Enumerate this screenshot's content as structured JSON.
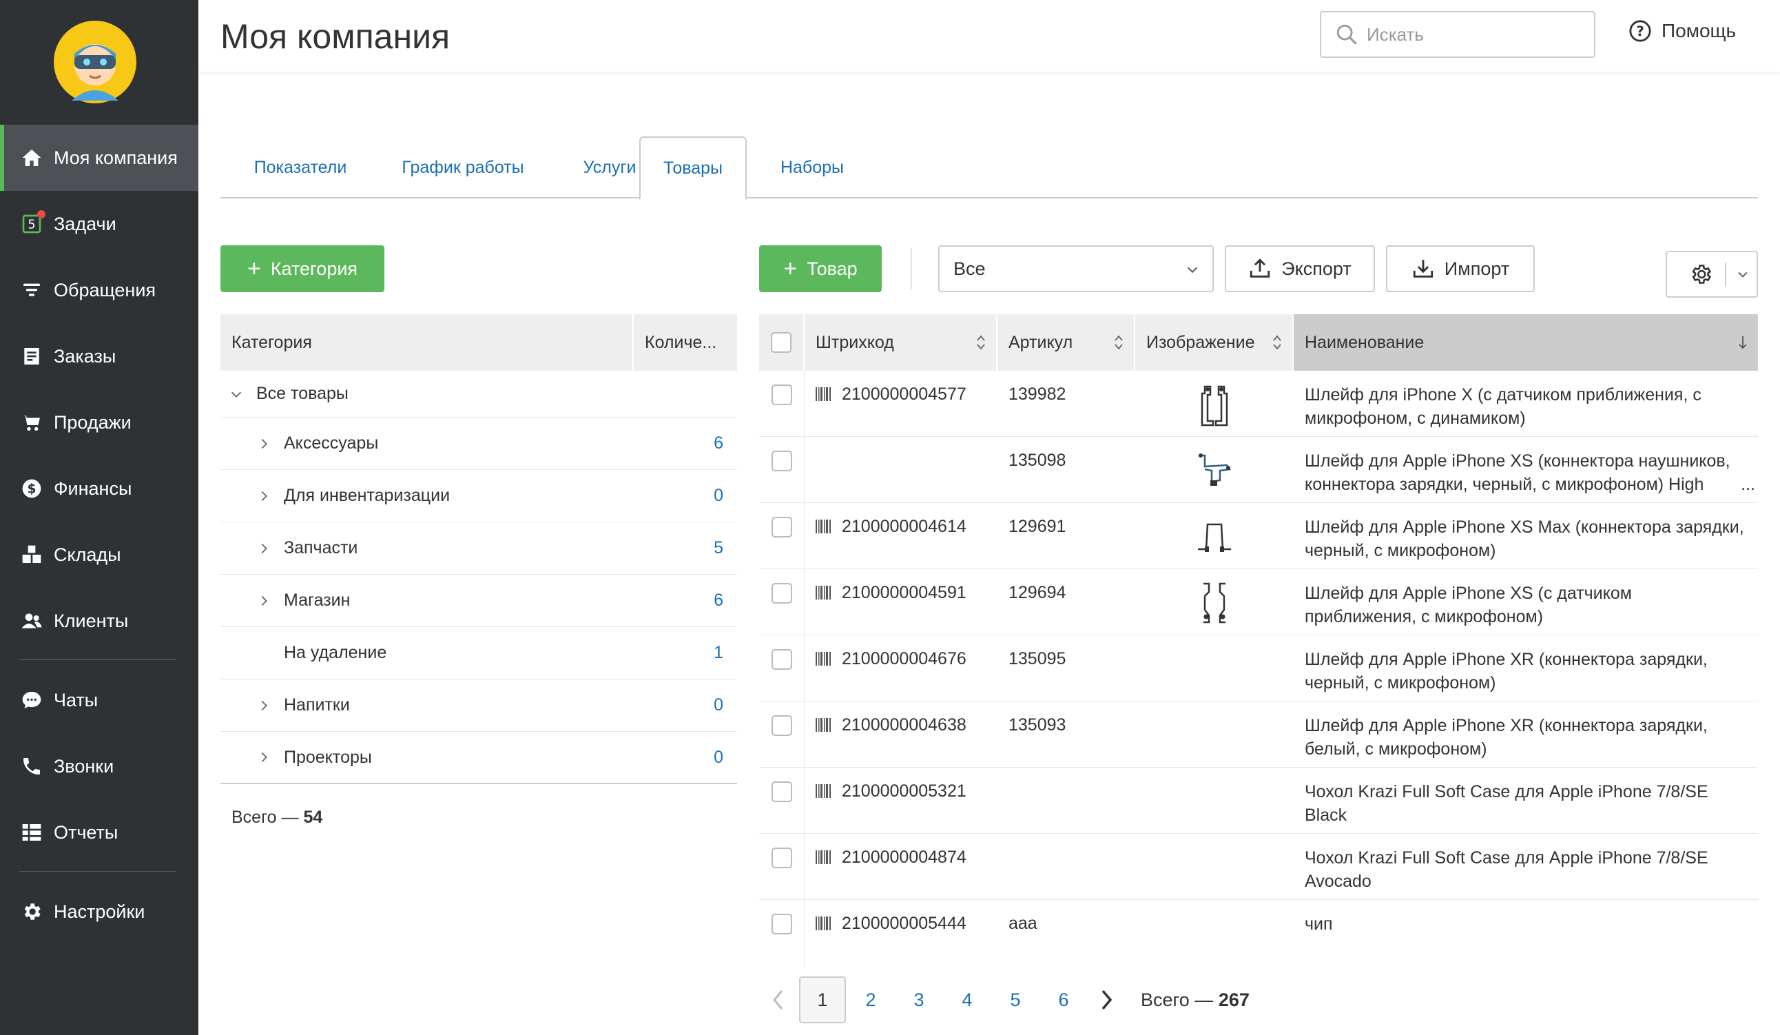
{
  "sidebar": {
    "items": [
      {
        "label": "Моя компания",
        "icon": "home-icon",
        "active": true
      },
      {
        "label": "Задачи",
        "icon": "tasks-icon",
        "badge": "5"
      },
      {
        "label": "Обращения",
        "icon": "funnel-icon"
      },
      {
        "label": "Заказы",
        "icon": "orders-icon"
      },
      {
        "label": "Продажи",
        "icon": "cart-icon"
      },
      {
        "label": "Финансы",
        "icon": "dollar-icon"
      },
      {
        "label": "Склады",
        "icon": "boxes-icon"
      },
      {
        "label": "Клиенты",
        "icon": "users-icon"
      },
      {
        "label": "Чаты",
        "icon": "chat-icon"
      },
      {
        "label": "Звонки",
        "icon": "phone-icon"
      },
      {
        "label": "Отчеты",
        "icon": "reports-icon"
      },
      {
        "label": "Настройки",
        "icon": "gear-icon"
      }
    ]
  },
  "header": {
    "title": "Моя компания",
    "search_placeholder": "Искать",
    "help_label": "Помощь"
  },
  "tabs": [
    {
      "label": "Показатели"
    },
    {
      "label": "График работы"
    },
    {
      "label": "Услуги"
    },
    {
      "label": "Товары",
      "active": true
    },
    {
      "label": "Наборы"
    }
  ],
  "toolbar": {
    "add_category_label": "Категория",
    "add_product_label": "Товар",
    "filter_value": "Все",
    "export_label": "Экспорт",
    "import_label": "Импорт"
  },
  "categories": {
    "header_name": "Категория",
    "header_count": "Количе...",
    "root_label": "Все товары",
    "items": [
      {
        "label": "Аксессуары",
        "count": "6",
        "expandable": true
      },
      {
        "label": "Для инвентаризации",
        "count": "0",
        "expandable": true
      },
      {
        "label": "Запчасти",
        "count": "5",
        "expandable": true
      },
      {
        "label": "Магазин",
        "count": "6",
        "expandable": true
      },
      {
        "label": "На удаление",
        "count": "1",
        "expandable": false
      },
      {
        "label": "Напитки",
        "count": "0",
        "expandable": true
      },
      {
        "label": "Проекторы",
        "count": "0",
        "expandable": true
      }
    ],
    "total_label": "Всего —",
    "total_value": "54"
  },
  "products": {
    "headers": {
      "barcode": "Штрихкод",
      "article": "Артикул",
      "image": "Изображение",
      "name": "Наименование"
    },
    "rows": [
      {
        "barcode": "2100000004577",
        "article": "139982",
        "has_image": true,
        "name_1": "Шлейф для iPhone X (с датчиком приближения, с",
        "name_2": "микрофоном, с динамиком)"
      },
      {
        "barcode": "",
        "article": "135098",
        "has_image": true,
        "name_1": "Шлейф для Apple iPhone XS (коннектора наушников,",
        "name_2": "коннектора зарядки, черный, с микрофоном) High",
        "ellipsis": "..."
      },
      {
        "barcode": "2100000004614",
        "article": "129691",
        "has_image": true,
        "name_1": "Шлейф для Apple iPhone XS Max (коннектора зарядки,",
        "name_2": "черный, с микрофоном)"
      },
      {
        "barcode": "2100000004591",
        "article": "129694",
        "has_image": true,
        "name_1": "Шлейф для Apple iPhone XS (с датчиком",
        "name_2": "приближения, с микрофоном)"
      },
      {
        "barcode": "2100000004676",
        "article": "135095",
        "has_image": false,
        "name_1": "Шлейф для Apple iPhone XR (коннектора зарядки,",
        "name_2": "черный, с микрофоном)"
      },
      {
        "barcode": "2100000004638",
        "article": "135093",
        "has_image": false,
        "name_1": "Шлейф для Apple iPhone XR (коннектора зарядки,",
        "name_2": "белый, с микрофоном)"
      },
      {
        "barcode": "2100000005321",
        "article": "",
        "has_image": false,
        "name_1": "Чохол Krazi Full Soft Case для Apple iPhone 7/8/SE",
        "name_2": "Black"
      },
      {
        "barcode": "2100000004874",
        "article": "",
        "has_image": false,
        "name_1": "Чохол Krazi Full Soft Case для Apple iPhone 7/8/SE",
        "name_2": "Avocado"
      },
      {
        "barcode": "2100000005444",
        "article": "aaa",
        "has_image": false,
        "name_1": "чип",
        "name_2": ""
      }
    ]
  },
  "pagination": {
    "pages": [
      "1",
      "2",
      "3",
      "4",
      "5",
      "6"
    ],
    "current": "1",
    "total_label": "Всего —",
    "total_value": "267"
  },
  "colors": {
    "accent_green": "#5cb85c",
    "link_blue": "#1a6fb5",
    "sidebar_bg": "#2f3235",
    "badge_red": "#e74c3c"
  }
}
